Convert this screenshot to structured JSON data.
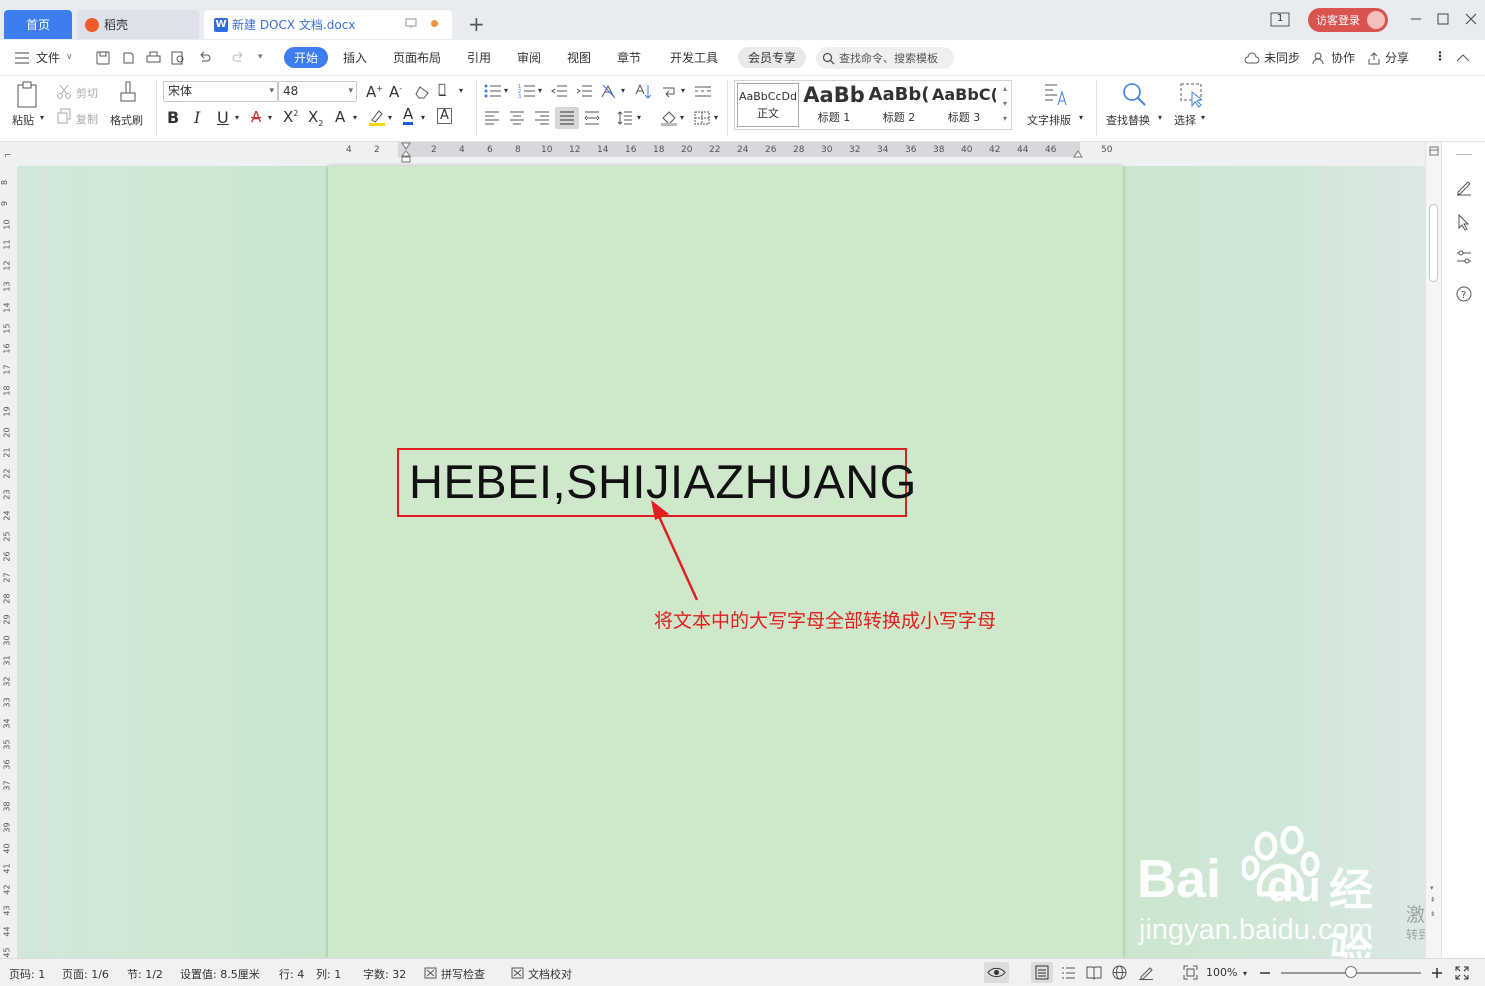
{
  "tabs": {
    "home": "首页",
    "daoke": "稻壳",
    "doc": "新建 DOCX 文档.docx"
  },
  "topbar": {
    "page_indicator": "1",
    "login": "访客登录"
  },
  "menu": {
    "file": "文件",
    "items": [
      "开始",
      "插入",
      "页面布局",
      "引用",
      "审阅",
      "视图",
      "章节",
      "开发工具",
      "会员专享"
    ],
    "search_placeholder": "查找命令、搜索模板",
    "sync": "未同步",
    "collab": "协作",
    "share": "分享"
  },
  "ribbon": {
    "paste": "粘贴",
    "cut": "剪切",
    "copy": "复制",
    "format_painter": "格式刷",
    "font_name": "宋体",
    "font_size": "48",
    "styles": [
      {
        "preview": "AaBbCcDd",
        "label": "正文"
      },
      {
        "preview": "AaBb",
        "label": "标题 1"
      },
      {
        "preview": "AaBb(",
        "label": "标题 2"
      },
      {
        "preview": "AaBbC(",
        "label": "标题 3"
      }
    ],
    "text_layout": "文字排版",
    "find_replace": "查找替换",
    "select": "选择"
  },
  "ruler": {
    "h_ticks": [
      "4",
      "2",
      "2",
      "4",
      "6",
      "8",
      "10",
      "12",
      "14",
      "16",
      "18",
      "20",
      "22",
      "24",
      "26",
      "28",
      "30",
      "32",
      "34",
      "36",
      "38",
      "40",
      "42",
      "44",
      "46",
      "50"
    ],
    "v_ticks": [
      "8",
      "9",
      "10",
      "11",
      "12",
      "13",
      "14",
      "15",
      "16",
      "17",
      "18",
      "19",
      "20",
      "21",
      "22",
      "23",
      "24",
      "25",
      "26",
      "27",
      "28",
      "29",
      "30",
      "31",
      "32",
      "33",
      "34",
      "35",
      "36",
      "37",
      "38",
      "39",
      "40",
      "41",
      "42",
      "43",
      "44",
      "45"
    ]
  },
  "document": {
    "text": "HEBEI,SHIJIAZHUANG",
    "annotation": "将文本中的大写字母全部转换成小写字母"
  },
  "watermark": {
    "brand": "Bai",
    "brand2": "du",
    "brand3": "经验",
    "url": "jingyan.baidu.com"
  },
  "activation": {
    "line1": "激活 Wir",
    "line2": "转到\"设置\"以"
  },
  "status": {
    "page_code": "页码: 1",
    "page": "页面: 1/6",
    "section": "节: 1/2",
    "setting": "设置值: 8.5厘米",
    "row": "行: 4",
    "col": "列: 1",
    "words": "字数: 32",
    "spellcheck": "拼写检查",
    "proof": "文档校对",
    "zoom": "100%"
  },
  "colors": {
    "accent": "#3c7ef0",
    "annotation": "#e0201f",
    "page_bg": "#cfe8cc"
  }
}
